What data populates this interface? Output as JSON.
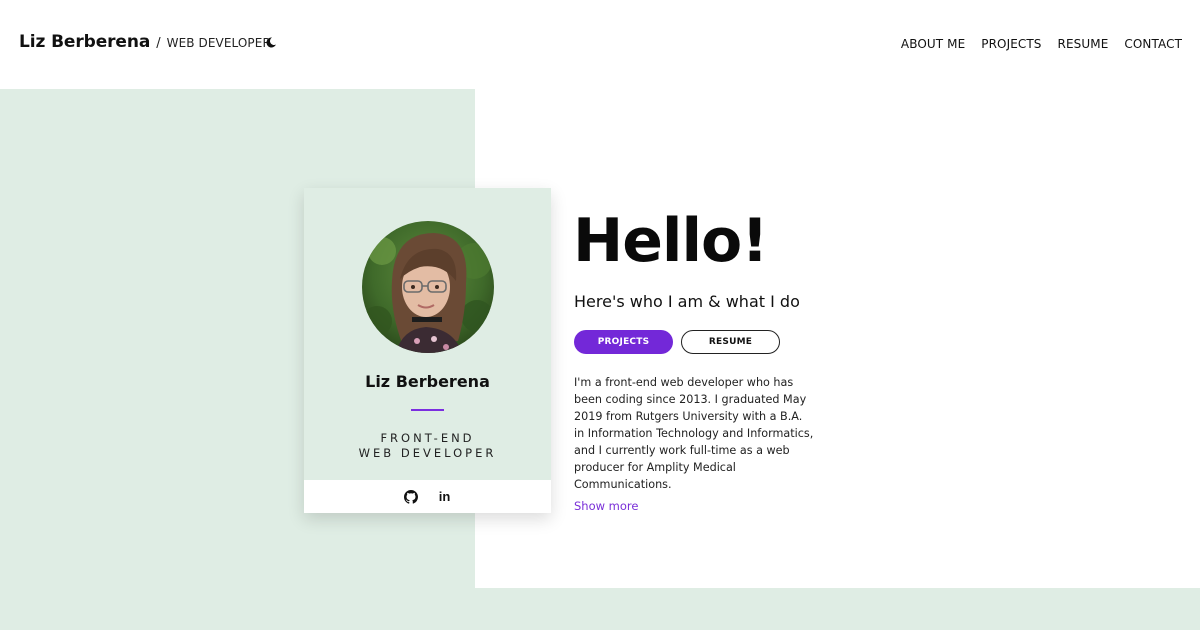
{
  "header": {
    "brand_name": "Liz Berberena",
    "separator": "/",
    "brand_role": "WEB DEVELOPER",
    "theme_icon": "moon-icon",
    "nav": [
      {
        "label": "ABOUT ME"
      },
      {
        "label": "PROJECTS"
      },
      {
        "label": "RESUME"
      },
      {
        "label": "CONTACT"
      }
    ]
  },
  "card": {
    "name": "Liz Berberena",
    "role_line1": "FRONT-END",
    "role_line2": "WEB DEVELOPER",
    "social": [
      {
        "icon": "github-icon"
      },
      {
        "icon": "linkedin-icon",
        "glyph": "in"
      }
    ]
  },
  "intro": {
    "heading": "Hello!",
    "subtitle": "Here's who I am & what I do",
    "buttons": {
      "projects": "PROJECTS",
      "resume": "RESUME"
    },
    "bio": "I'm a front-end web developer who has been coding since 2013. I graduated May 2019 from Rutgers University with a B.A. in Information Technology and Informatics, and I currently work full-time as a web producer for Amplity Medical Communications.",
    "show_more": "Show more"
  },
  "colors": {
    "mint_background": "#dfede4",
    "accent_purple": "#7328d8",
    "link_purple": "#7a2fd8"
  }
}
